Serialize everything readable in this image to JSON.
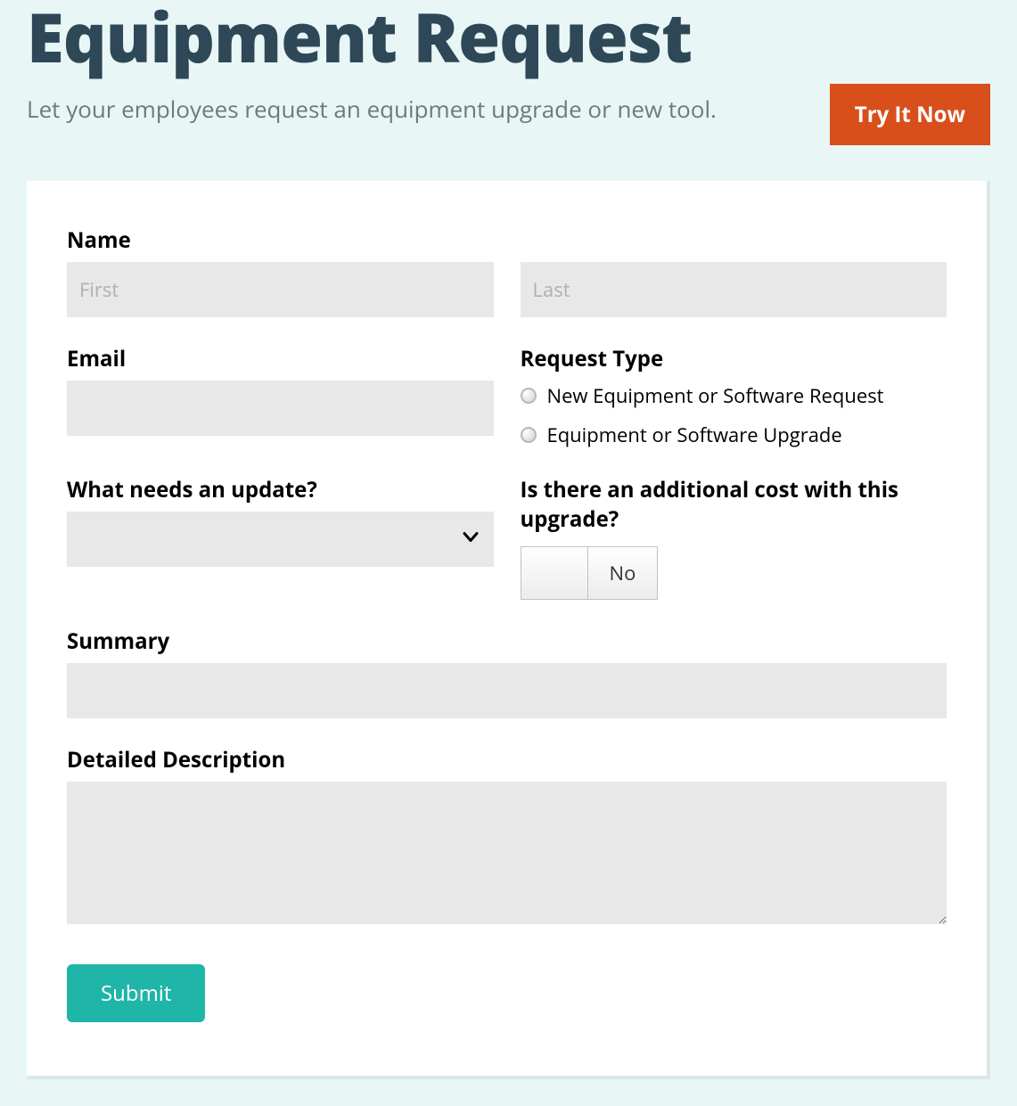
{
  "header": {
    "title": "Equipment Request",
    "subtitle": "Let your employees request an equipment upgrade or new tool.",
    "try_button": "Try It Now"
  },
  "form": {
    "name": {
      "label": "Name",
      "first_placeholder": "First",
      "last_placeholder": "Last"
    },
    "email": {
      "label": "Email"
    },
    "request_type": {
      "label": "Request Type",
      "options": [
        "New Equipment or Software Request",
        "Equipment or Software Upgrade"
      ]
    },
    "update_target": {
      "label": "What needs an update?"
    },
    "additional_cost": {
      "label": "Is there an additional cost with this upgrade?",
      "value": "No"
    },
    "summary": {
      "label": "Summary"
    },
    "description": {
      "label": "Detailed Description"
    },
    "submit_label": "Submit"
  }
}
